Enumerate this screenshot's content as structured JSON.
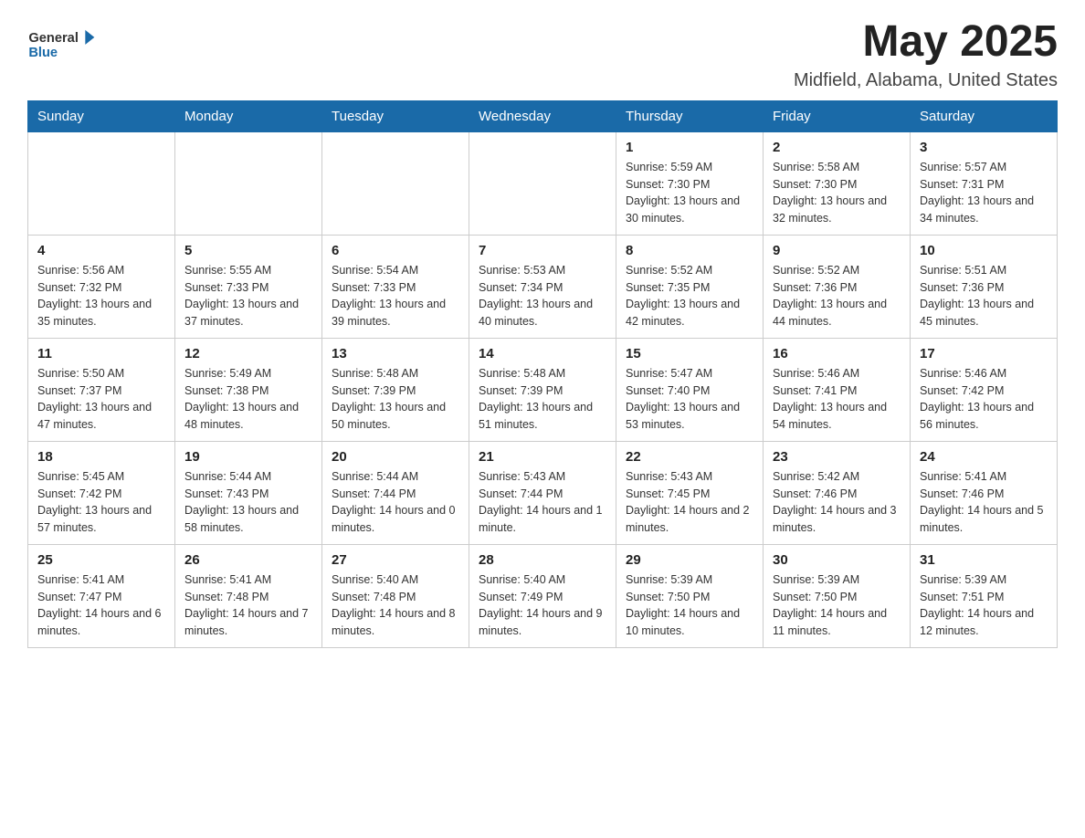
{
  "header": {
    "logo_general": "General",
    "logo_blue": "Blue",
    "month_title": "May 2025",
    "location": "Midfield, Alabama, United States"
  },
  "weekdays": [
    "Sunday",
    "Monday",
    "Tuesday",
    "Wednesday",
    "Thursday",
    "Friday",
    "Saturday"
  ],
  "weeks": [
    [
      {
        "day": "",
        "sunrise": "",
        "sunset": "",
        "daylight": ""
      },
      {
        "day": "",
        "sunrise": "",
        "sunset": "",
        "daylight": ""
      },
      {
        "day": "",
        "sunrise": "",
        "sunset": "",
        "daylight": ""
      },
      {
        "day": "",
        "sunrise": "",
        "sunset": "",
        "daylight": ""
      },
      {
        "day": "1",
        "sunrise": "Sunrise: 5:59 AM",
        "sunset": "Sunset: 7:30 PM",
        "daylight": "Daylight: 13 hours and 30 minutes."
      },
      {
        "day": "2",
        "sunrise": "Sunrise: 5:58 AM",
        "sunset": "Sunset: 7:30 PM",
        "daylight": "Daylight: 13 hours and 32 minutes."
      },
      {
        "day": "3",
        "sunrise": "Sunrise: 5:57 AM",
        "sunset": "Sunset: 7:31 PM",
        "daylight": "Daylight: 13 hours and 34 minutes."
      }
    ],
    [
      {
        "day": "4",
        "sunrise": "Sunrise: 5:56 AM",
        "sunset": "Sunset: 7:32 PM",
        "daylight": "Daylight: 13 hours and 35 minutes."
      },
      {
        "day": "5",
        "sunrise": "Sunrise: 5:55 AM",
        "sunset": "Sunset: 7:33 PM",
        "daylight": "Daylight: 13 hours and 37 minutes."
      },
      {
        "day": "6",
        "sunrise": "Sunrise: 5:54 AM",
        "sunset": "Sunset: 7:33 PM",
        "daylight": "Daylight: 13 hours and 39 minutes."
      },
      {
        "day": "7",
        "sunrise": "Sunrise: 5:53 AM",
        "sunset": "Sunset: 7:34 PM",
        "daylight": "Daylight: 13 hours and 40 minutes."
      },
      {
        "day": "8",
        "sunrise": "Sunrise: 5:52 AM",
        "sunset": "Sunset: 7:35 PM",
        "daylight": "Daylight: 13 hours and 42 minutes."
      },
      {
        "day": "9",
        "sunrise": "Sunrise: 5:52 AM",
        "sunset": "Sunset: 7:36 PM",
        "daylight": "Daylight: 13 hours and 44 minutes."
      },
      {
        "day": "10",
        "sunrise": "Sunrise: 5:51 AM",
        "sunset": "Sunset: 7:36 PM",
        "daylight": "Daylight: 13 hours and 45 minutes."
      }
    ],
    [
      {
        "day": "11",
        "sunrise": "Sunrise: 5:50 AM",
        "sunset": "Sunset: 7:37 PM",
        "daylight": "Daylight: 13 hours and 47 minutes."
      },
      {
        "day": "12",
        "sunrise": "Sunrise: 5:49 AM",
        "sunset": "Sunset: 7:38 PM",
        "daylight": "Daylight: 13 hours and 48 minutes."
      },
      {
        "day": "13",
        "sunrise": "Sunrise: 5:48 AM",
        "sunset": "Sunset: 7:39 PM",
        "daylight": "Daylight: 13 hours and 50 minutes."
      },
      {
        "day": "14",
        "sunrise": "Sunrise: 5:48 AM",
        "sunset": "Sunset: 7:39 PM",
        "daylight": "Daylight: 13 hours and 51 minutes."
      },
      {
        "day": "15",
        "sunrise": "Sunrise: 5:47 AM",
        "sunset": "Sunset: 7:40 PM",
        "daylight": "Daylight: 13 hours and 53 minutes."
      },
      {
        "day": "16",
        "sunrise": "Sunrise: 5:46 AM",
        "sunset": "Sunset: 7:41 PM",
        "daylight": "Daylight: 13 hours and 54 minutes."
      },
      {
        "day": "17",
        "sunrise": "Sunrise: 5:46 AM",
        "sunset": "Sunset: 7:42 PM",
        "daylight": "Daylight: 13 hours and 56 minutes."
      }
    ],
    [
      {
        "day": "18",
        "sunrise": "Sunrise: 5:45 AM",
        "sunset": "Sunset: 7:42 PM",
        "daylight": "Daylight: 13 hours and 57 minutes."
      },
      {
        "day": "19",
        "sunrise": "Sunrise: 5:44 AM",
        "sunset": "Sunset: 7:43 PM",
        "daylight": "Daylight: 13 hours and 58 minutes."
      },
      {
        "day": "20",
        "sunrise": "Sunrise: 5:44 AM",
        "sunset": "Sunset: 7:44 PM",
        "daylight": "Daylight: 14 hours and 0 minutes."
      },
      {
        "day": "21",
        "sunrise": "Sunrise: 5:43 AM",
        "sunset": "Sunset: 7:44 PM",
        "daylight": "Daylight: 14 hours and 1 minute."
      },
      {
        "day": "22",
        "sunrise": "Sunrise: 5:43 AM",
        "sunset": "Sunset: 7:45 PM",
        "daylight": "Daylight: 14 hours and 2 minutes."
      },
      {
        "day": "23",
        "sunrise": "Sunrise: 5:42 AM",
        "sunset": "Sunset: 7:46 PM",
        "daylight": "Daylight: 14 hours and 3 minutes."
      },
      {
        "day": "24",
        "sunrise": "Sunrise: 5:41 AM",
        "sunset": "Sunset: 7:46 PM",
        "daylight": "Daylight: 14 hours and 5 minutes."
      }
    ],
    [
      {
        "day": "25",
        "sunrise": "Sunrise: 5:41 AM",
        "sunset": "Sunset: 7:47 PM",
        "daylight": "Daylight: 14 hours and 6 minutes."
      },
      {
        "day": "26",
        "sunrise": "Sunrise: 5:41 AM",
        "sunset": "Sunset: 7:48 PM",
        "daylight": "Daylight: 14 hours and 7 minutes."
      },
      {
        "day": "27",
        "sunrise": "Sunrise: 5:40 AM",
        "sunset": "Sunset: 7:48 PM",
        "daylight": "Daylight: 14 hours and 8 minutes."
      },
      {
        "day": "28",
        "sunrise": "Sunrise: 5:40 AM",
        "sunset": "Sunset: 7:49 PM",
        "daylight": "Daylight: 14 hours and 9 minutes."
      },
      {
        "day": "29",
        "sunrise": "Sunrise: 5:39 AM",
        "sunset": "Sunset: 7:50 PM",
        "daylight": "Daylight: 14 hours and 10 minutes."
      },
      {
        "day": "30",
        "sunrise": "Sunrise: 5:39 AM",
        "sunset": "Sunset: 7:50 PM",
        "daylight": "Daylight: 14 hours and 11 minutes."
      },
      {
        "day": "31",
        "sunrise": "Sunrise: 5:39 AM",
        "sunset": "Sunset: 7:51 PM",
        "daylight": "Daylight: 14 hours and 12 minutes."
      }
    ]
  ]
}
